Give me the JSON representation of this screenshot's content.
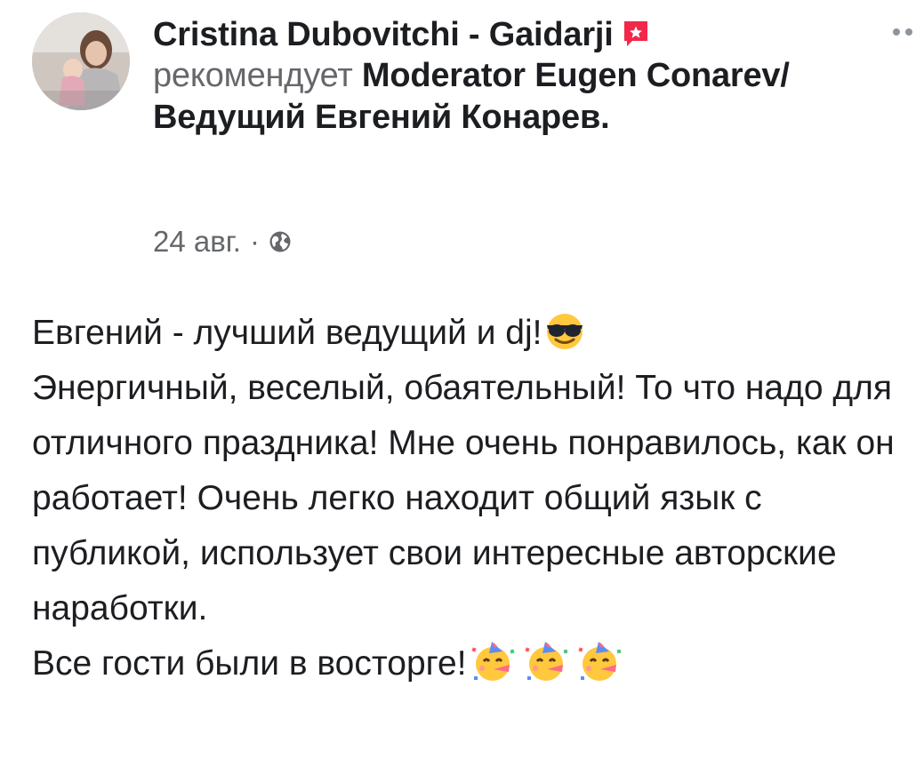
{
  "post": {
    "author": "Cristina Dubovitchi - Gaidarji",
    "action": "рекомендует",
    "page": "Moderator Eugen Conarev/ Ведущий Евгений Конарев.",
    "date": "24 авг.",
    "separator": "·",
    "icons": {
      "avatar": "profile-photo",
      "flag": "recommendation-flag-icon",
      "privacy": "globe-icon",
      "more": "more-options-icon",
      "emoji_first": "sunglasses-emoji",
      "emoji_party": "party-face-emoji"
    },
    "content": {
      "lines": [
        "Евгений - лучший ведущий и dj!",
        "Энергичный, веселый, обаятельный! То что надо для отличного праздника! Мне очень понравилось, как он работает! Очень легко находит общий язык с публикой, использует свои интересные авторские наработки.",
        "Все гости были в восторге!"
      ]
    }
  },
  "colors": {
    "text": "#1c1e21",
    "secondary": "#65676b",
    "flag": "#f02849"
  }
}
